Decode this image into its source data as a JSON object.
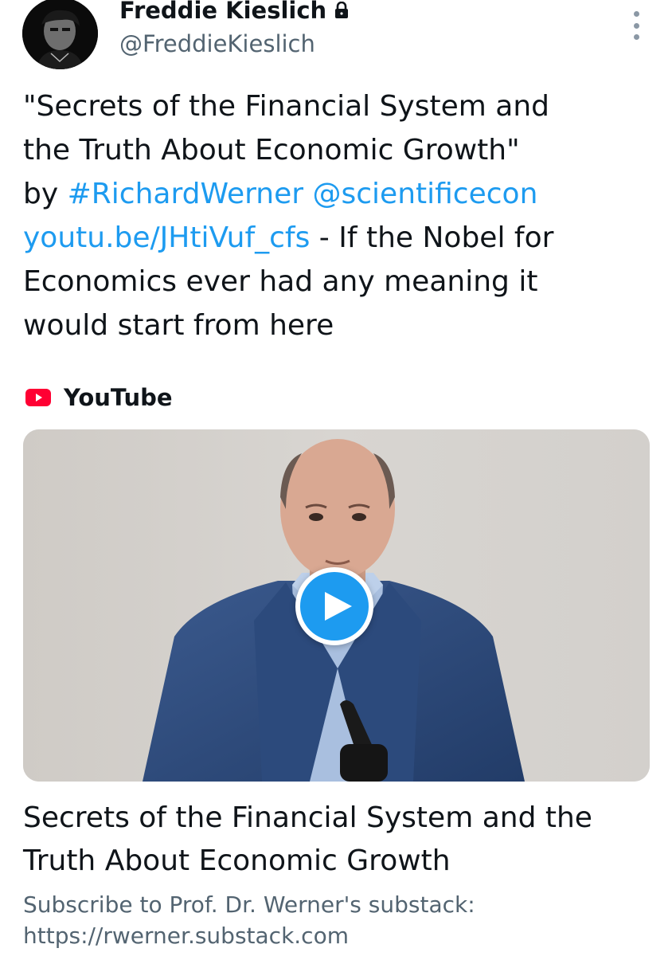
{
  "author": {
    "display_name": "Freddie Kieslich",
    "handle": "@FreddieKieslich",
    "protected_icon": "lock-icon",
    "avatar_icon": "avatar"
  },
  "tweet": {
    "line1": "\"Secrets of the Financial System and",
    "line2": "the Truth About Economic Growth\"",
    "line3_prefix": "by ",
    "hashtag": "#RichardWerner",
    "mention": "@scientificecon",
    "link": "youtu.be/JHtiVuf_cfs",
    "line4_suffix": " - If the Nobel for",
    "line5": "Economics ever had any meaning it",
    "line6": "would start from here"
  },
  "card": {
    "source_label": "YouTube",
    "source_icon": "youtube-icon",
    "play_icon": "play-icon",
    "title_line1": "Secrets of the Financial System and the",
    "title_line2": "Truth About Economic Growth",
    "desc_line1": "Subscribe to Prof. Dr. Werner's substack:",
    "desc_line2": "https://rwerner.substack.com"
  },
  "colors": {
    "link": "#1d9bf0",
    "text": "#0f1419",
    "secondary": "#536471",
    "youtube_red": "#ff0033",
    "play_button": "#1d9bf0"
  }
}
